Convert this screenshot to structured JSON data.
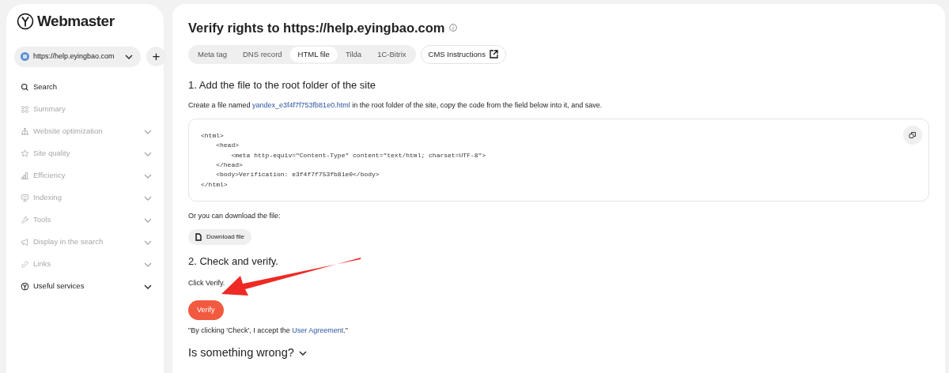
{
  "sidebar": {
    "logo": "Webmaster",
    "site_select": {
      "value": "https://help.eyingbao.com"
    },
    "add_button": "+",
    "items": [
      {
        "label": "Search",
        "disabled": false,
        "expandable": false
      },
      {
        "label": "Summary",
        "disabled": true,
        "expandable": false
      },
      {
        "label": "Website optimization",
        "disabled": true,
        "expandable": true
      },
      {
        "label": "Site quality",
        "disabled": true,
        "expandable": true
      },
      {
        "label": "Efficiency",
        "disabled": true,
        "expandable": true
      },
      {
        "label": "Indexing",
        "disabled": true,
        "expandable": true
      },
      {
        "label": "Tools",
        "disabled": true,
        "expandable": true
      },
      {
        "label": "Display in the search",
        "disabled": true,
        "expandable": true
      },
      {
        "label": "Links",
        "disabled": true,
        "expandable": true
      },
      {
        "label": "Useful services",
        "disabled": false,
        "expandable": true
      }
    ]
  },
  "main": {
    "title": "Verify rights to https://help.eyingbao.com",
    "tabs": [
      {
        "label": "Meta tag",
        "selected": false
      },
      {
        "label": "DNS record",
        "selected": false
      },
      {
        "label": "HTML file",
        "selected": true
      },
      {
        "label": "Tilda",
        "selected": false
      },
      {
        "label": "1C-Bitrix",
        "selected": false
      }
    ],
    "cms_button": "CMS Instructions",
    "step1": {
      "heading": "1. Add the file to the root folder of the site",
      "text_before": "Create a file named ",
      "file_link": "yandex_e3f4f7f753fb81e0.html",
      "text_after": " in the root folder of the site, copy the code from the field below into it, and save.",
      "code": [
        "<html>",
        "    <head>",
        "        <meta http-equiv=\"Content-Type\" content=\"text/html; charset=UTF-8\">",
        "    </head>",
        "    <body>Verification: e3f4f7f753fb81e0</body>",
        "</html>"
      ],
      "download_text": "Or you can download the file:",
      "download_button": "Download file"
    },
    "step2": {
      "heading": "2. Check and verify.",
      "text": "Click Verify.",
      "verify_button": "Verify",
      "agreement_before": "\"By clicking 'Check', I accept the ",
      "agreement_link": "User Agreement",
      "agreement_after": ".\""
    },
    "help": "Is something wrong?"
  }
}
